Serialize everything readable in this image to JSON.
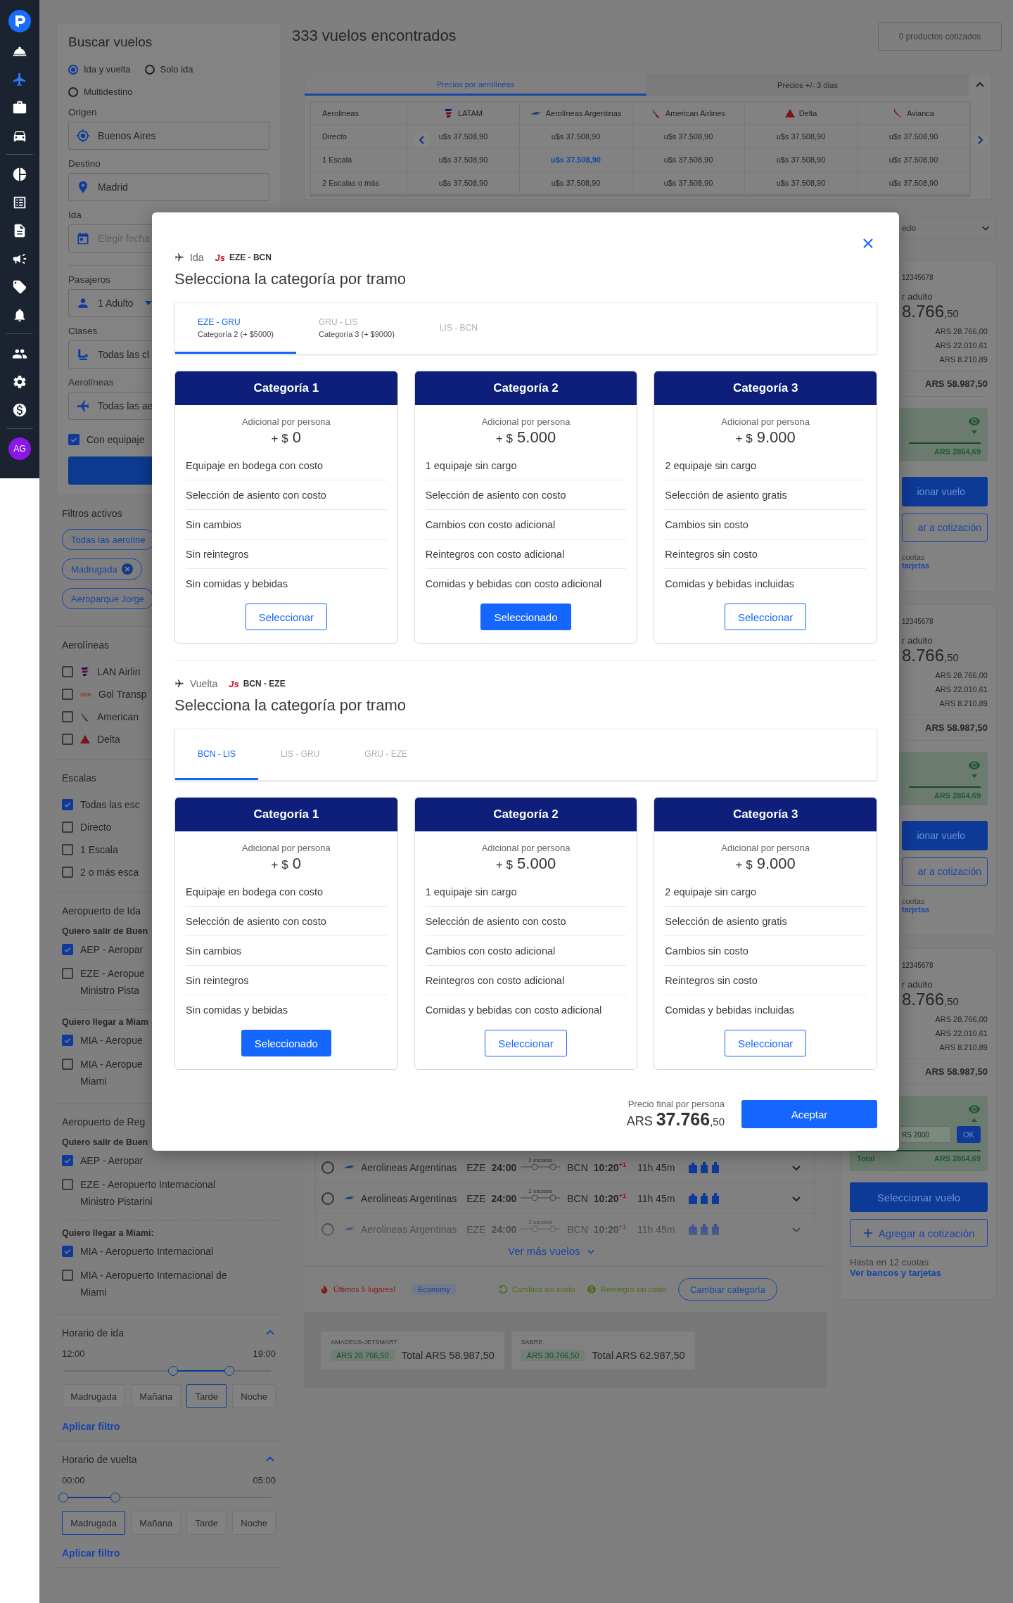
{
  "nav": {
    "groups": [
      {
        "items": [
          {
            "selected": false
          },
          {
            "selected": true
          },
          {
            "selected": false
          },
          {
            "selected": false
          }
        ]
      },
      {
        "items": [
          {
            "selected": false
          },
          {
            "selected": false
          },
          {
            "selected": false
          },
          {
            "selected": false
          },
          {
            "selected": false
          },
          {
            "selected": false
          }
        ]
      },
      {
        "items": [
          {
            "selected": false
          },
          {
            "selected": false
          },
          {
            "selected": false
          }
        ]
      }
    ],
    "avatar": "AG"
  },
  "search": {
    "title": "Buscar vuelos",
    "trip_types": [
      {
        "label": "Ida y vuelta",
        "selected": true
      },
      {
        "label": "Solo ida",
        "selected": false
      },
      {
        "label": "Multidestino",
        "selected": false
      }
    ],
    "fields": [
      {
        "label": "Origen",
        "value": "Buenos Aires",
        "kind": "origin"
      },
      {
        "label": "Destino",
        "value": "Madrid",
        "kind": "destination"
      },
      {
        "label": "Ida",
        "placeholder": "Elegir fecha",
        "kind": "date"
      },
      {
        "label": "Pasajeros",
        "value": "1 Adulto",
        "kind": "passengers"
      },
      {
        "label": "Clases",
        "value": "Todas las cl",
        "kind": "class"
      },
      {
        "label": "Aerolíneas",
        "value": "Todas las ae",
        "kind": "airline"
      }
    ],
    "baggage": {
      "label": "Con equipaje",
      "checked": true
    }
  },
  "active_filters": {
    "title": "Filtros activos",
    "chips": [
      {
        "label": "Todas las aerolíne",
        "removable": false
      },
      {
        "label": "Madrugada",
        "removable": true
      },
      {
        "label": "Aeroparque Jorge",
        "removable": false
      }
    ]
  },
  "airline_filter": {
    "title": "Aerolíneas",
    "items": [
      {
        "label": "LAN Airlin",
        "kind": "latam",
        "checked": false
      },
      {
        "label": "Gol Transp",
        "kind": "gol",
        "logo_text": "GOL",
        "checked": false
      },
      {
        "label": "American",
        "kind": "american",
        "checked": false
      },
      {
        "label": "Delta",
        "kind": "delta",
        "checked": false
      }
    ]
  },
  "stops_filter": {
    "title": "Escalas",
    "items": [
      {
        "label": "Todas las esc",
        "checked": true
      },
      {
        "label": "Directo",
        "checked": false
      },
      {
        "label": "1 Escala",
        "checked": false
      },
      {
        "label": "2 o más esca",
        "checked": false
      }
    ]
  },
  "airport_filters": [
    {
      "title": "Aeropuerto de Ida",
      "groups": [
        {
          "label": "Quiero salir de Buen",
          "items": [
            {
              "lines": [
                "AEP - Aeropar"
              ],
              "checked": true
            },
            {
              "lines": [
                "EZE - Aeropue",
                "Ministro Pista"
              ],
              "checked": false
            }
          ]
        },
        {
          "label": "Quiero llegar a Miam",
          "items": [
            {
              "lines": [
                "MIA - Aeropue"
              ],
              "checked": true
            },
            {
              "lines": [
                "MIA - Aeropue",
                "Miami"
              ],
              "checked": false
            }
          ]
        }
      ]
    },
    {
      "title": "Aeropuerto de Reg",
      "groups": [
        {
          "label": "Quiero salir de Buen",
          "items": [
            {
              "lines": [
                "AEP - Aeropar"
              ],
              "checked": true
            },
            {
              "lines": [
                "EZE - Aeropuerto Internacional",
                "Ministro Pistarini"
              ],
              "checked": false
            }
          ]
        },
        {
          "label": "Quiero llegar a Miami:",
          "items": [
            {
              "lines": [
                "MIA - Aeropuerto Internacional"
              ],
              "checked": true
            },
            {
              "lines": [
                "MIA - Aeropuerto Internacional de",
                "Miami"
              ],
              "checked": false
            }
          ]
        }
      ]
    }
  ],
  "time_filters": [
    {
      "title": "Horario de ida",
      "expanded": true,
      "start": "12:00",
      "end": "19:00",
      "thumbs": [
        {
          "level": 0.53
        },
        {
          "level": 0.8
        }
      ],
      "periods": [
        {
          "label": "Madrugada",
          "selected": false
        },
        {
          "label": "Mañana",
          "selected": false
        },
        {
          "label": "Tarde",
          "selected": true
        },
        {
          "label": "Noche",
          "selected": false
        }
      ],
      "apply": "Aplicar filtro"
    },
    {
      "title": "Horario de vuelta",
      "expanded": true,
      "start": "00:00",
      "end": "05:00",
      "thumbs": [
        {
          "level": 0.0
        },
        {
          "level": 0.25
        }
      ],
      "periods": [
        {
          "label": "Madrugada",
          "selected": true
        },
        {
          "label": "Mañana",
          "selected": false
        },
        {
          "label": "Tarde",
          "selected": false
        },
        {
          "label": "Noche",
          "selected": false
        }
      ],
      "apply": "Aplicar filtro"
    }
  ],
  "results": {
    "title": "333 vuelos encontrados",
    "quoted": "0 productos cotizados"
  },
  "price_matrix": {
    "expanded": true,
    "tabs": [
      {
        "label": "Precios por aerolíneas",
        "selected": true
      },
      {
        "label": "Precios +/- 3 días",
        "selected": false
      }
    ],
    "columns": [
      {
        "label": "Aerolineas"
      },
      {
        "label": "LATAM",
        "kind": "latam"
      },
      {
        "label": "Aerolíneas Argentinas",
        "kind": "aerolineas"
      },
      {
        "label": "American Airlines",
        "kind": "american"
      },
      {
        "label": "Delta",
        "kind": "delta"
      },
      {
        "label": "Avianca",
        "kind": "avianca"
      }
    ],
    "rows": [
      {
        "cells": [
          {
            "text": "Directo",
            "highlighted": false
          },
          {
            "text": "u$s 37.508,90",
            "highlighted": false
          },
          {
            "text": "u$s 37.508,90",
            "highlighted": false
          },
          {
            "text": "u$s 37.508,90",
            "highlighted": false
          },
          {
            "text": "u$s 37.508,90",
            "highlighted": false
          },
          {
            "text": "u$s 37.508,90",
            "highlighted": false
          }
        ]
      },
      {
        "cells": [
          {
            "text": "1 Escala",
            "highlighted": false
          },
          {
            "text": "u$s 37.508,90",
            "highlighted": false
          },
          {
            "text": "u$s 37.508,90",
            "highlighted": true
          },
          {
            "text": "u$s 37.508,90",
            "highlighted": false
          },
          {
            "text": "u$s 37.508,90",
            "highlighted": false
          },
          {
            "text": "u$s 37.508,90",
            "highlighted": false
          }
        ]
      },
      {
        "cells": [
          {
            "text": "2 Escalas o más",
            "highlighted": false
          },
          {
            "text": "u$s 37.508,90",
            "highlighted": false
          },
          {
            "text": "u$s 37.508,90",
            "highlighted": false
          },
          {
            "text": "u$s 37.508,90",
            "highlighted": false
          },
          {
            "text": "u$s 37.508,90",
            "highlighted": false
          },
          {
            "text": "u$s 37.508,90",
            "highlighted": false
          }
        ]
      }
    ]
  },
  "sort": {
    "value": "ecio"
  },
  "fare_cards": [
    {
      "code": "12345678",
      "label": "r adulto",
      "amount": "8.766",
      "cents": ",50",
      "breakdown": [
        "ARS 28.766,00",
        "ARS 22.010,61",
        "ARS 8.210,89"
      ],
      "total": "ARS 58.987,50",
      "fee": {
        "expanded": false,
        "amount": "ARS 2864,69"
      },
      "select": "ionar vuelo",
      "quote": "ar a cotización",
      "installments": "cuotas",
      "banks": "tarjetas"
    },
    {
      "code": "12345678",
      "label": "r adulto",
      "amount": "8.766",
      "cents": ",50",
      "breakdown": [
        "ARS 28.766,00",
        "ARS 22.010,61",
        "ARS 8.210,89"
      ],
      "total": "ARS 58.987,50",
      "fee": {
        "expanded": false,
        "amount": "ARS 2864,69"
      },
      "select": "ionar vuelo",
      "quote": "ar a cotización",
      "installments": "cuotas",
      "banks": "tarjetas"
    }
  ],
  "fare_card_last": {
    "code": "12345678",
    "label": "r adulto",
    "amount": "8.766",
    "cents": ",50",
    "breakdown": [
      "ARS 28.766,00",
      "ARS 22.010,61",
      "ARS 8.210,89"
    ],
    "total": "ARS 58.987,50",
    "fee": {
      "expanded": true,
      "input": "RS 2000",
      "ok": "OK",
      "total_label": "Total",
      "amount": "ARS 2864,69"
    },
    "select": "Seleccionar vuelo",
    "quote": "Agregar a cotización",
    "installments": "Hasta en 12 cuotas",
    "banks": "Ver bancos y tarjetas"
  },
  "flights": [
    {
      "airline": "Aerolineas Argentinas",
      "from": "EZE",
      "departure": "24:00",
      "stops": "2 escalas",
      "to": "BCN",
      "arrival": "10:20",
      "day_offset": "+1",
      "duration": "11h 45m",
      "selected": false
    },
    {
      "airline": "Aerolineas Argentinas",
      "from": "EZE",
      "departure": "24:00",
      "stops": "2 escalas",
      "to": "BCN",
      "arrival": "10:20",
      "day_offset": "+1",
      "duration": "11h 45m",
      "selected": false
    },
    {
      "airline": "Aerolineas Argentinas",
      "from": "EZE",
      "departure": "24:00",
      "stops": "2 escalas",
      "to": "BCN",
      "arrival": "10:20",
      "day_offset": "+1",
      "duration": "11h 45m",
      "selected": false
    }
  ],
  "more_flights": "Ver más vuelos",
  "fare_tags": {
    "urgency": "Últimos 5 lugares!",
    "cabin": "Economy",
    "changes": "Cambios sin costo",
    "refund": "Reintegro sin costo",
    "change_category": "Cambiar categoría"
  },
  "providers": [
    {
      "name": "AMADEUS-JETSMART",
      "price": "ARS 28.766,50",
      "total": "Total ARS 58.987,50"
    },
    {
      "name": "SABRE",
      "price": "ARS 30.766,50",
      "total": "Total ARS 62.987,50"
    }
  ],
  "modal": {
    "sections": [
      {
        "direction": "Ida",
        "carrier": "Js",
        "route": "EZE - BCN",
        "title": "Selecciona la categoría por tramo",
        "legs": [
          {
            "label": "EZE - GRU",
            "detail": "Categoría 2 (+ $5000)",
            "selected": true
          },
          {
            "label": "GRU - LIS",
            "detail": "Categoría 3 (+ $9000)",
            "selected": false
          },
          {
            "label": "LIS - BCN",
            "selected": false
          }
        ],
        "categories": [
          {
            "name": "Categoría 1",
            "note": "Adicional por persona",
            "prefix": "+ $",
            "amount": "0",
            "features": [
              "Equipaje en bodega con costo",
              "Selección de asiento con costo",
              "Sin cambios",
              "Sin reintegros",
              "Sin comidas y bebidas"
            ],
            "button": "Seleccionar",
            "selected": false
          },
          {
            "name": "Categoría 2",
            "note": "Adicional por persona",
            "prefix": "+ $",
            "amount": "5.000",
            "features": [
              "1 equipaje sin cargo",
              "Selección de asiento con costo",
              "Cambios con costo adicional",
              "Reintegros con costo adicional",
              "Comidas y bebidas con costo adicional"
            ],
            "button": "Seleccionado",
            "selected": true
          },
          {
            "name": "Categoría 3",
            "note": "Adicional por persona",
            "prefix": "+ $",
            "amount": "9.000",
            "features": [
              "2 equipaje sin cargo",
              "Selección de asiento gratis",
              "Cambios sin costo",
              "Reintegros sin costo",
              "Comidas y bebidas incluidas"
            ],
            "button": "Seleccionar",
            "selected": false
          }
        ]
      },
      {
        "direction": "Vuelta",
        "carrier": "Js",
        "route": "BCN - EZE",
        "title": "Selecciona la categoría por tramo",
        "legs": [
          {
            "label": "BCN - LIS",
            "selected": true
          },
          {
            "label": "LIS - GRU",
            "selected": false
          },
          {
            "label": "GRU - EZE",
            "selected": false
          }
        ],
        "categories": [
          {
            "name": "Categoría 1",
            "note": "Adicional por persona",
            "prefix": "+ $",
            "amount": "0",
            "features": [
              "Equipaje en bodega con costo",
              "Selección de asiento con costo",
              "Sin cambios",
              "Sin reintegros",
              "Sin comidas y bebidas"
            ],
            "button": "Seleccionado",
            "selected": true
          },
          {
            "name": "Categoría 2",
            "note": "Adicional por persona",
            "prefix": "+ $",
            "amount": "5.000",
            "features": [
              "1 equipaje sin cargo",
              "Selección de asiento con costo",
              "Cambios con costo adicional",
              "Reintegros con costo adicional",
              "Comidas y bebidas con costo adicional"
            ],
            "button": "Seleccionar",
            "selected": false
          },
          {
            "name": "Categoría 3",
            "note": "Adicional por persona",
            "prefix": "+ $",
            "amount": "9.000",
            "features": [
              "2 equipaje sin cargo",
              "Selección de asiento gratis",
              "Cambios sin costo",
              "Reintegros sin costo",
              "Comidas y bebidas incluidas"
            ],
            "button": "Seleccionar",
            "selected": false
          }
        ]
      }
    ],
    "footer": {
      "label": "Precio final por persona",
      "currency": "ARS",
      "amount": "37.766",
      "cents": ",50",
      "button": "Aceptar"
    }
  }
}
